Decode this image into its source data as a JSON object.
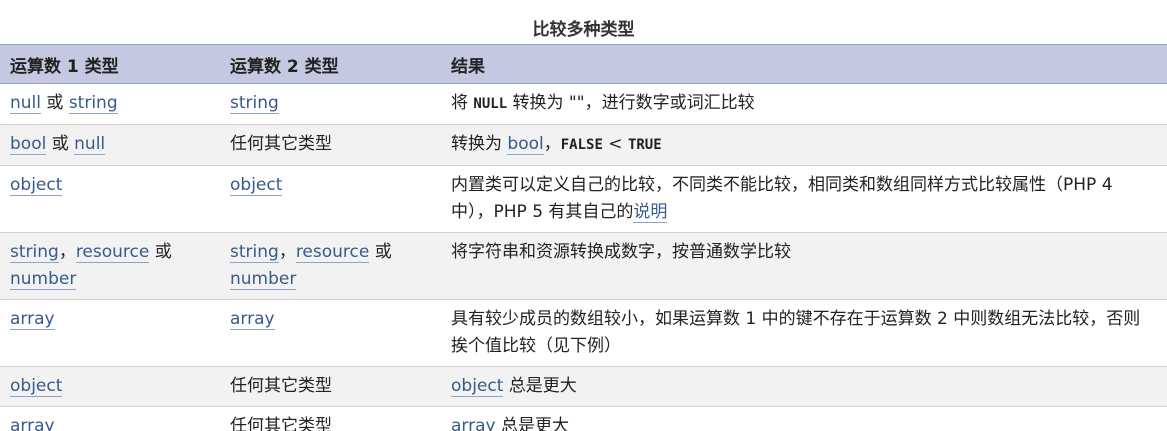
{
  "caption": "比较多种类型",
  "headers": {
    "col1": "运算数 1 类型",
    "col2": "运算数 2 类型",
    "col3": "结果"
  },
  "rows": [
    {
      "op1": {
        "link1": "null",
        "sep1": " 或 ",
        "link2": "string"
      },
      "op2": {
        "link1": "string"
      },
      "result": {
        "t1": "将 ",
        "code1": "NULL",
        "t2": " 转换为 \"\"，进行数字或词汇比较"
      }
    },
    {
      "op1": {
        "link1": "bool",
        "sep1": " 或 ",
        "link2": "null"
      },
      "op2": {
        "text": "任何其它类型"
      },
      "result": {
        "t1": "转换为 ",
        "link1": "bool",
        "t2": "，",
        "code1": "FALSE",
        "t3": " < ",
        "code2": "TRUE"
      }
    },
    {
      "op1": {
        "link1": "object"
      },
      "op2": {
        "link1": "object"
      },
      "result": {
        "t1": "内置类可以定义自己的比较，不同类不能比较，相同类和数组同样方式比较属性（PHP 4 中），PHP 5 有其自己的",
        "link1": "说明"
      }
    },
    {
      "op1": {
        "link1": "string",
        "sep1": "，",
        "link2": "resource",
        "sep2": " 或 ",
        "link3": "number"
      },
      "op2": {
        "link1": "string",
        "sep1": "，",
        "link2": "resource",
        "sep2": " 或 ",
        "link3": "number"
      },
      "result": {
        "t1": "将字符串和资源转换成数字，按普通数学比较"
      }
    },
    {
      "op1": {
        "link1": "array"
      },
      "op2": {
        "link1": "array"
      },
      "result": {
        "t1": "具有较少成员的数组较小，如果运算数 1 中的键不存在于运算数 2 中则数组无法比较，否则挨个值比较（见下例）"
      }
    },
    {
      "op1": {
        "link1": "object"
      },
      "op2": {
        "text": "任何其它类型"
      },
      "result": {
        "link1": "object",
        "t1": " 总是更大"
      }
    },
    {
      "op1": {
        "link1": "array"
      },
      "op2": {
        "text": "任何其它类型"
      },
      "result": {
        "link1": "array",
        "t1": " 总是更大"
      }
    }
  ],
  "colors": {
    "header_bg": "#c4c9e1",
    "stripe_bg": "#f2f2f2",
    "link": "#375a8c"
  }
}
